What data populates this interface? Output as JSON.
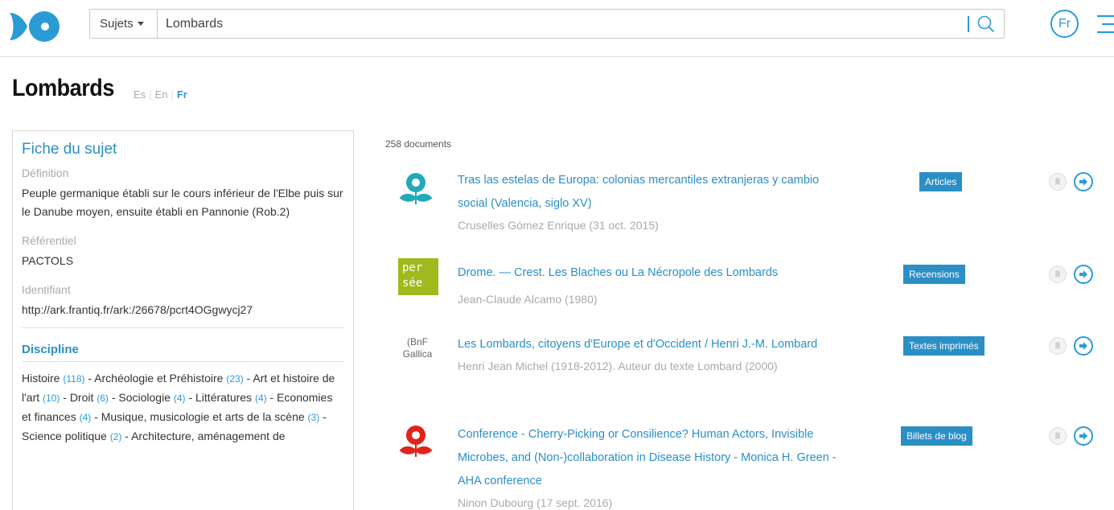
{
  "header": {
    "subjects_label": "Sujets",
    "search_value": "Lombards",
    "lang_button": "Fr",
    "accent_color": "#2b9bd6"
  },
  "page": {
    "title": "Lombards",
    "languages": [
      "Es",
      "En",
      "Fr"
    ],
    "active_language": "Fr"
  },
  "fiche": {
    "heading": "Fiche du sujet",
    "definition_label": "Définition",
    "definition": "Peuple germanique établi sur le cours inférieur de l'Elbe puis sur le Danube moyen, ensuite établi en Pannonie (Rob.2)",
    "referentiel_label": "Référentiel",
    "referentiel": "PACTOLS",
    "identifiant_label": "Identifiant",
    "identifiant": "http://ark.frantiq.fr/ark:/26678/pcrt4OGgwycj27",
    "discipline_label": "Discipline",
    "disciplines": [
      {
        "name": "Histoire",
        "count": "(118)"
      },
      {
        "name": "Archéologie et Préhistoire",
        "count": "(23)"
      },
      {
        "name": "Art et histoire de l'art",
        "count": "(10)"
      },
      {
        "name": "Droit",
        "count": "(6)"
      },
      {
        "name": "Sociologie",
        "count": "(4)"
      },
      {
        "name": "Littératures",
        "count": "(4)"
      },
      {
        "name": "Economies et finances",
        "count": "(4)"
      },
      {
        "name": "Musique, musicologie et arts de la scène",
        "count": "(3)"
      },
      {
        "name": "Science politique",
        "count": "(2)"
      },
      {
        "name": "Architecture, aménagement de",
        "count": ""
      }
    ]
  },
  "results": {
    "count_label": "258 documents",
    "items": [
      {
        "source": "openedition-books",
        "title": "Tras las estelas de Europa: colonias mercantiles extranjeras y cambio social (Valencia, siglo XV)",
        "author": "Cruselles Gómez Enrique (31 oct. 2015)",
        "type": "Articles"
      },
      {
        "source": "persee",
        "logo_text": [
          "per",
          "sée"
        ],
        "title": "Drome. — Crest. Les Blaches ou La Nécropole des Lombards",
        "author": "Jean-Claude Alcamo (1980)",
        "type": "Recensions"
      },
      {
        "source": "gallica",
        "logo_text": [
          "(BnF",
          "Gallica"
        ],
        "title": "Les Lombards, citoyens d'Europe et d'Occident / Henri J.-M. Lombard",
        "author": "Henri Jean Michel (1918-2012). Auteur du texte Lombard (2000)",
        "type": "Textes imprimés"
      },
      {
        "source": "hypotheses",
        "title": "Conference - Cherry-Picking or Consilience? Human Actors, Invisible Microbes, and (Non-)collaboration in Disease History - Monica H. Green - AHA conference",
        "author": "Ninon Dubourg (17 sept. 2016)",
        "type": "Billets de blog"
      }
    ]
  }
}
